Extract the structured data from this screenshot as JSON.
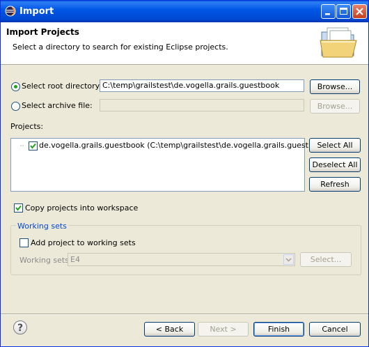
{
  "window": {
    "title": "Import",
    "controls": [
      "minimize",
      "maximize",
      "close"
    ]
  },
  "header": {
    "title": "Import Projects",
    "description": "Select a directory to search for existing Eclipse projects.",
    "icon": "folder-import-icon"
  },
  "source": {
    "root_label": "Select root directory:",
    "root_selected": true,
    "root_value": "C:\\temp\\grailstest\\de.vogella.grails.guestbook",
    "root_browse": "Browse...",
    "archive_label": "Select archive file:",
    "archive_selected": false,
    "archive_value": "",
    "archive_browse": "Browse..."
  },
  "projects": {
    "label": "Projects:",
    "items": [
      {
        "label": "de.vogella.grails.guestbook (C:\\temp\\grailstest\\de.vogella.grails.guestbook)",
        "checked": true
      }
    ],
    "select_all": "Select All",
    "deselect_all": "Deselect All",
    "refresh": "Refresh"
  },
  "options": {
    "copy_label": "Copy projects into workspace",
    "copy_checked": true
  },
  "working_sets": {
    "group_title": "Working sets",
    "add_label": "Add project to working sets",
    "add_checked": false,
    "sets_label": "Working sets:",
    "sets_value": "E4",
    "select_button": "Select..."
  },
  "footer": {
    "back": "< Back",
    "next": "Next >",
    "finish": "Finish",
    "cancel": "Cancel"
  }
}
